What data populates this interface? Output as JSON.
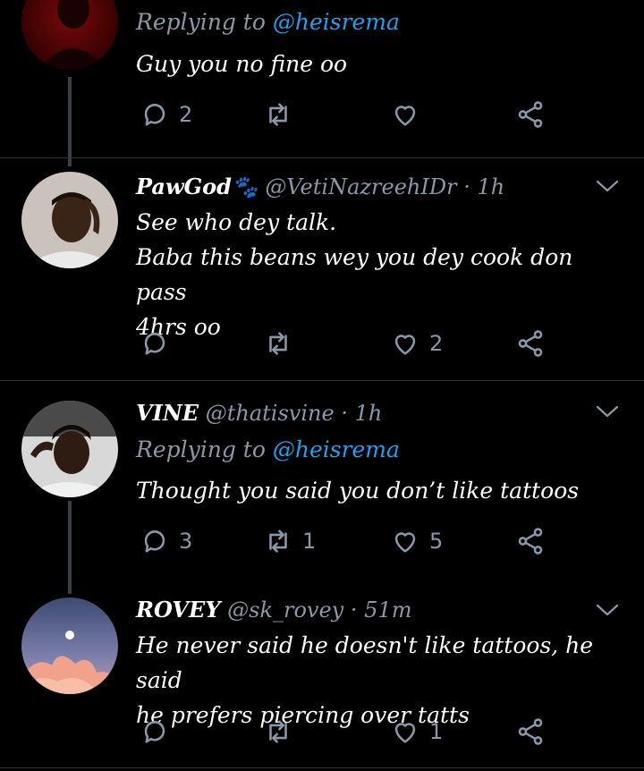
{
  "tweets": [
    {
      "reply_prefix": "Replying to",
      "reply_to": "@heisrema",
      "text_lines": [
        "Guy you no fine oo"
      ],
      "replies": "2",
      "retweets": "",
      "likes": ""
    },
    {
      "display_name": "PawGod🐾",
      "handle": "@VetiNazreehIDr",
      "time": "1h",
      "text_lines": [
        "See who dey talk.",
        "Baba this beans wey you dey cook don pass",
        "4hrs oo"
      ],
      "replies": "",
      "retweets": "",
      "likes": "2"
    },
    {
      "display_name": "VINE",
      "handle": "@thatisvine",
      "time": "1h",
      "reply_prefix": "Replying to",
      "reply_to": "@heisrema",
      "text_lines": [
        "Thought you said you don’t like tattoos"
      ],
      "replies": "3",
      "retweets": "1",
      "likes": "5"
    },
    {
      "display_name": "ROVEY",
      "handle": "@sk_rovey",
      "time": "51m",
      "text_lines": [
        "He never said he doesn't like tattoos, he said",
        "he prefers piercing over tatts"
      ],
      "replies": "",
      "retweets": "",
      "likes": "1"
    }
  ],
  "separator": "·",
  "colors": {
    "background": "#000000",
    "text": "#ffffff",
    "secondary": "#8899a6",
    "accent": "#1da1f2",
    "divider": "#2f3336"
  },
  "icons": [
    "reply-icon",
    "retweet-icon",
    "like-icon",
    "share-icon",
    "chevron-down-icon"
  ]
}
